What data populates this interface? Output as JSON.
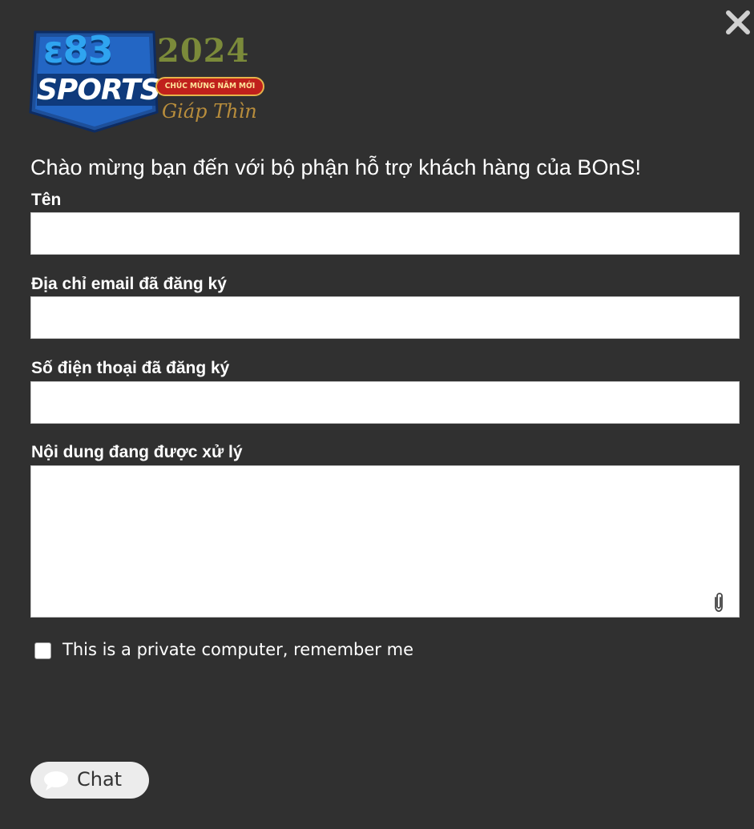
{
  "logo": {
    "brand_top": "ɛ83",
    "brand_mid": "SPORTS",
    "year": "2024",
    "ribbon": "CHÚC MỪNG NĂM MỚI",
    "subtitle": "Giáp Thìn"
  },
  "header": {
    "welcome": "Chào mừng bạn đến với bộ phận hỗ trợ khách hàng của BOnS!"
  },
  "form": {
    "name_label": "Tên",
    "name_value": "",
    "email_label": "Địa chỉ email đã đăng ký",
    "email_value": "",
    "phone_label": "Số điện thoại đã đăng ký",
    "phone_value": "",
    "message_label": "Nội dung đang được xử lý",
    "message_value": "",
    "remember_label": "This is a private computer, remember me",
    "remember_checked": false
  },
  "footer": {
    "chat_label": "Chat"
  },
  "icons": {
    "close": "close-icon",
    "attach": "paperclip-icon",
    "chat": "chat-bubble-icon"
  },
  "colors": {
    "background": "#303030",
    "text": "#ffffff",
    "input_bg": "#ffffff",
    "chat_button_bg": "#ececec"
  }
}
